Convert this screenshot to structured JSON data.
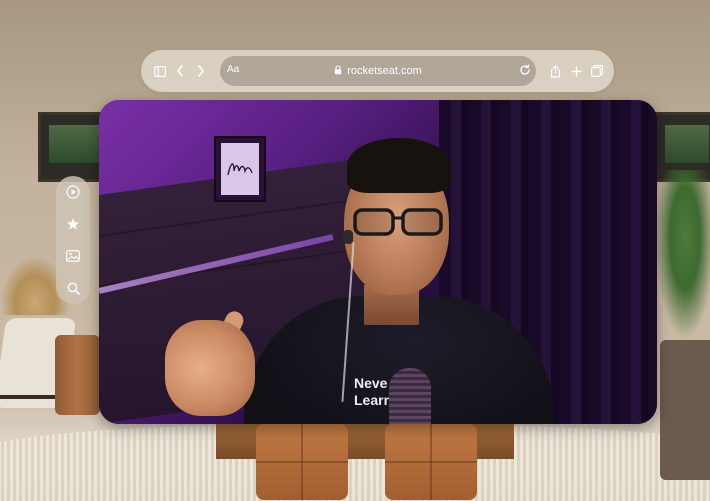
{
  "browser": {
    "url": "rocketseat.com",
    "reader_label": "Aa",
    "icons": {
      "sidebar_toggle": "sidebar-toggle-icon",
      "back": "chevron-left-icon",
      "forward": "chevron-right-icon",
      "lock": "lock-icon",
      "reload": "reload-icon",
      "share": "share-icon",
      "new_tab": "plus-icon",
      "tabs": "tabs-overview-icon"
    }
  },
  "sidebar": {
    "items": [
      {
        "icon": "play-icon"
      },
      {
        "icon": "star-sparkle-icon"
      },
      {
        "icon": "photo-icon"
      },
      {
        "icon": "search-icon"
      }
    ]
  },
  "video": {
    "shirt_text_line1": "Neve",
    "shirt_text_line2": "Learn"
  }
}
